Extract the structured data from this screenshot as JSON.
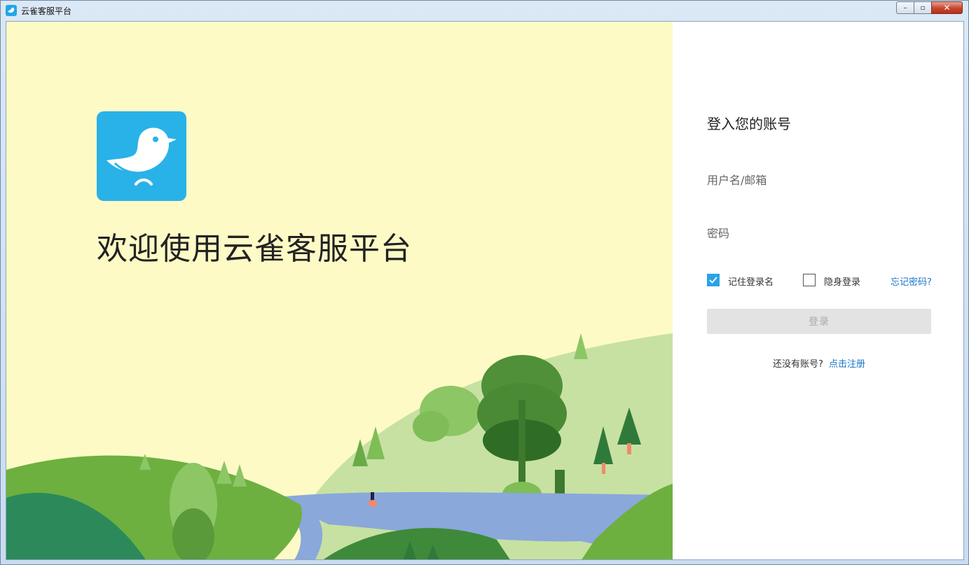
{
  "window": {
    "title": "云雀客服平台",
    "controls": {
      "minimize": "–",
      "maximize": "▫",
      "close": "✕"
    }
  },
  "left": {
    "logo_icon": "bird-logo-icon",
    "welcome_text": "欢迎使用云雀客服平台"
  },
  "login": {
    "heading": "登入您的账号",
    "username_placeholder": "用户名/邮箱",
    "password_placeholder": "密码",
    "remember_label": "记住登录名",
    "remember_checked": true,
    "invisible_label": "隐身登录",
    "invisible_checked": false,
    "forgot_label": "忘记密码?",
    "submit_label": "登录",
    "no_account_text": "还没有账号?",
    "register_label": "点击注册"
  },
  "colors": {
    "brand": "#29b2e8",
    "link": "#1976c8",
    "panel_bg": "#fdfac6"
  }
}
